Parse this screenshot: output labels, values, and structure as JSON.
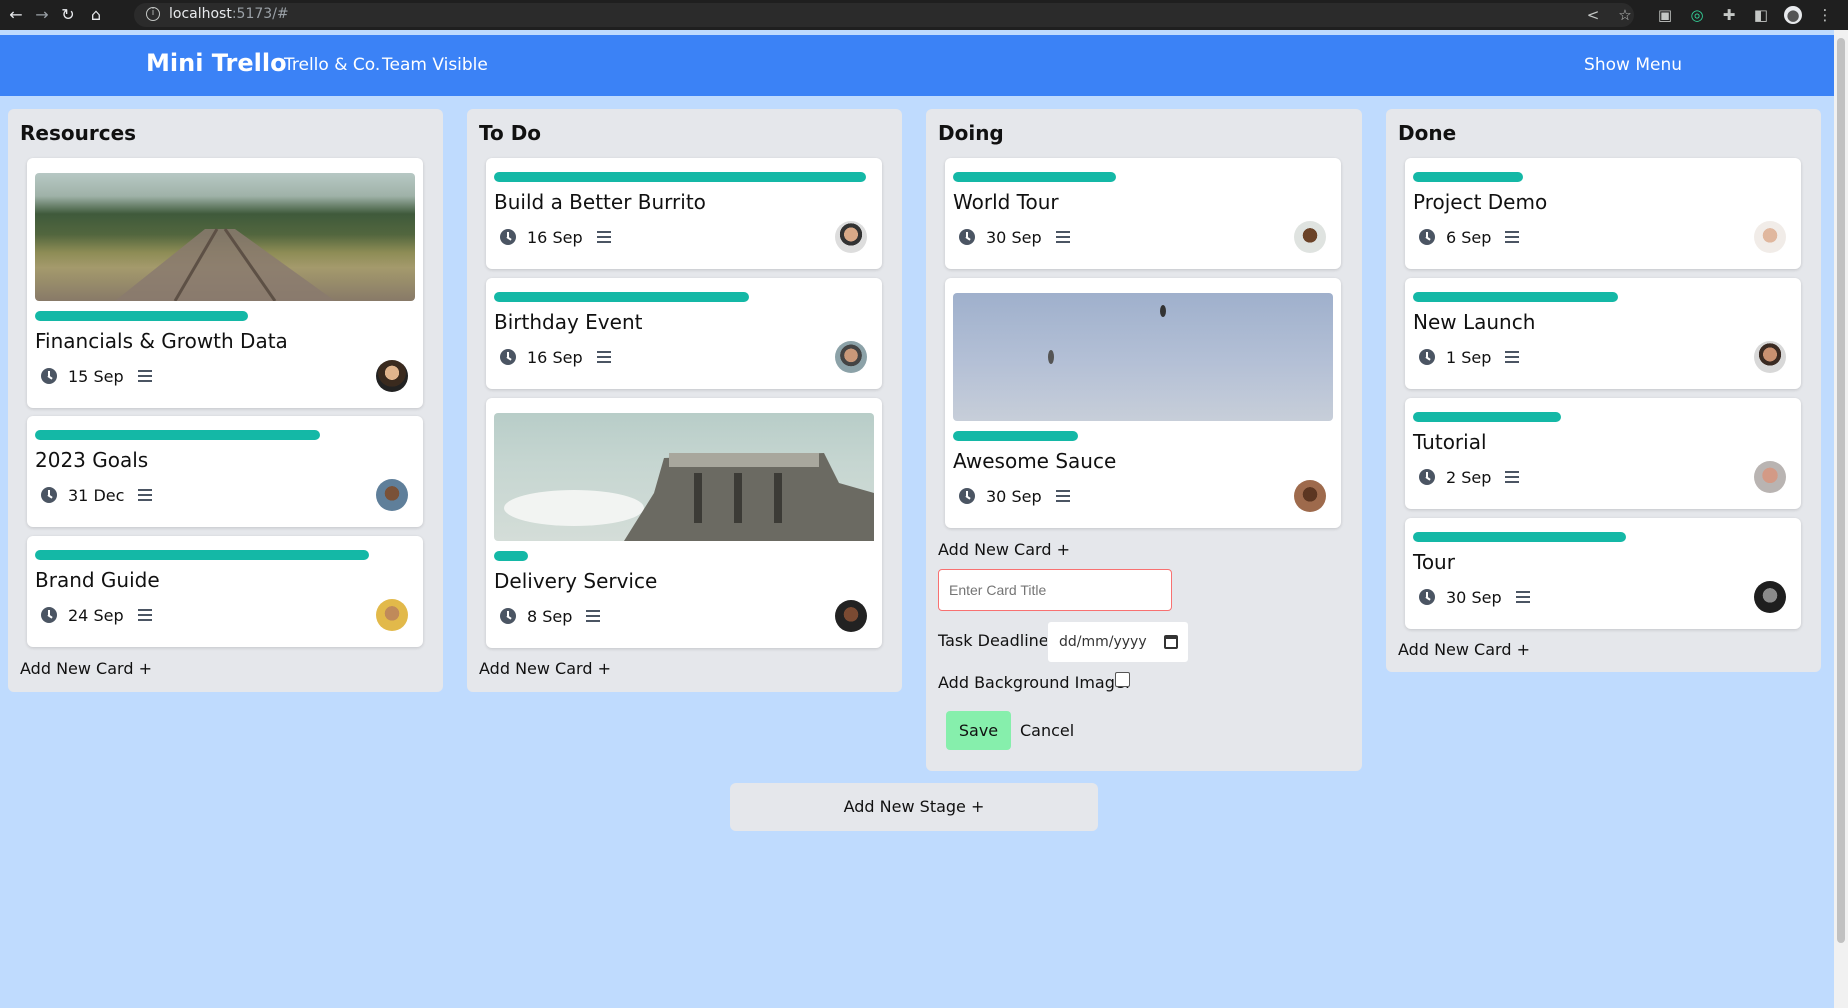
{
  "browser": {
    "url_host": "localhost",
    "url_rest": ":5173/#"
  },
  "header": {
    "title": "Mini Trello",
    "workspace": "Trello & Co.",
    "visibility": "Team Visible",
    "menu_label": "Show Menu"
  },
  "stages": [
    {
      "title": "Resources",
      "add_card_label": "Add New Card +",
      "cards": [
        {
          "title": "Financials & Growth Data",
          "date": "15 Sep",
          "image": "railroad-forest",
          "progress": 0.56
        },
        {
          "title": "2023 Goals",
          "date": "31 Dec",
          "progress": 0.75
        },
        {
          "title": "Brand Guide",
          "date": "24 Sep",
          "progress": 0.88
        }
      ]
    },
    {
      "title": "To Do",
      "add_card_label": "Add New Card +",
      "cards": [
        {
          "title": "Build a Better Burrito",
          "date": "16 Sep",
          "progress": 0.98
        },
        {
          "title": "Birthday Event",
          "date": "16 Sep",
          "progress": 0.67
        },
        {
          "title": "Delivery Service",
          "date": "8 Sep",
          "image": "concrete-building",
          "progress": 0.09
        }
      ]
    },
    {
      "title": "Doing",
      "add_card_label": "Add New Card +",
      "cards": [
        {
          "title": "World Tour",
          "date": "30 Sep",
          "progress": 0.43
        },
        {
          "title": "Awesome Sauce",
          "date": "30 Sep",
          "image": "sky-birds",
          "progress": 0.33
        }
      ],
      "form": {
        "title_placeholder": "Enter Card Title",
        "deadline_label": "Task Deadline:",
        "deadline_value": "dd/mm/yyyy",
        "background_label": "Add Background Image:",
        "background_checked": false,
        "save_label": "Save",
        "cancel_label": "Cancel"
      }
    },
    {
      "title": "Done",
      "add_card_label": "Add New Card +",
      "cards": [
        {
          "title": "Project Demo",
          "date": "6 Sep",
          "progress": 0.29
        },
        {
          "title": "New Launch",
          "date": "1 Sep",
          "progress": 0.54
        },
        {
          "title": "Tutorial",
          "date": "2 Sep",
          "progress": 0.39
        },
        {
          "title": "Tour",
          "date": "30 Sep",
          "progress": 0.56
        }
      ]
    }
  ],
  "add_stage_label": "Add New Stage +",
  "colors": {
    "header": "#3b82f6",
    "board_bg": "#bfdbfe",
    "stage_bg": "#e5e7eb",
    "progress_bar": "#14b8a6",
    "save_button": "#86efac"
  }
}
